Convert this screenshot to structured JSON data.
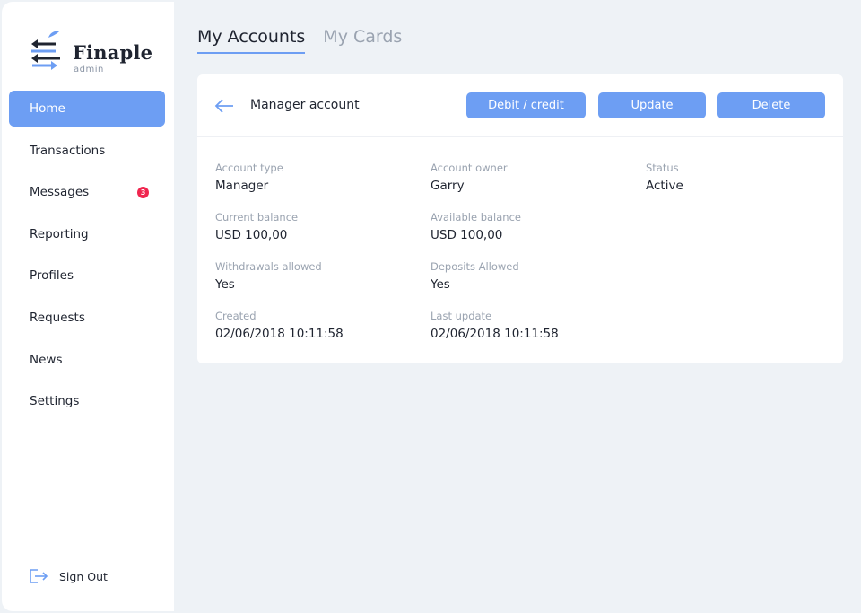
{
  "brand": {
    "name": "Finaple",
    "subtitle": "admin"
  },
  "sidebar": {
    "items": [
      {
        "label": "Home",
        "active": true
      },
      {
        "label": "Transactions"
      },
      {
        "label": "Messages",
        "badge": "3"
      },
      {
        "label": "Reporting"
      },
      {
        "label": "Profiles"
      },
      {
        "label": "Requests"
      },
      {
        "label": "News"
      },
      {
        "label": "Settings"
      }
    ],
    "signout_label": "Sign Out"
  },
  "tabs": [
    {
      "label": "My Accounts",
      "active": true
    },
    {
      "label": "My Cards",
      "active": false
    }
  ],
  "card": {
    "title": "Manager account",
    "buttons": {
      "debit_credit": "Debit / credit",
      "update": "Update",
      "delete": "Delete"
    },
    "fields": {
      "account_type": {
        "label": "Account type",
        "value": "Manager"
      },
      "account_owner": {
        "label": "Account owner",
        "value": "Garry"
      },
      "status": {
        "label": "Status",
        "value": "Active"
      },
      "current_balance": {
        "label": "Current balance",
        "value": "USD 100,00"
      },
      "available_balance": {
        "label": "Available balance",
        "value": "USD 100,00"
      },
      "withdrawals_allowed": {
        "label": "Withdrawals allowed",
        "value": "Yes"
      },
      "deposits_allowed": {
        "label": "Deposits Allowed",
        "value": "Yes"
      },
      "created": {
        "label": "Created",
        "value": "02/06/2018 10:11:58"
      },
      "last_update": {
        "label": "Last update",
        "value": "02/06/2018 10:11:58"
      }
    }
  },
  "colors": {
    "accent": "#6d9ef3",
    "badge": "#f0264f",
    "background": "#eef2f6",
    "text": "#1f2430",
    "muted": "#9aa3b0"
  },
  "icons": {
    "logo": "arrows-logo-icon",
    "back": "arrow-left-icon",
    "signout": "sign-out-icon"
  }
}
